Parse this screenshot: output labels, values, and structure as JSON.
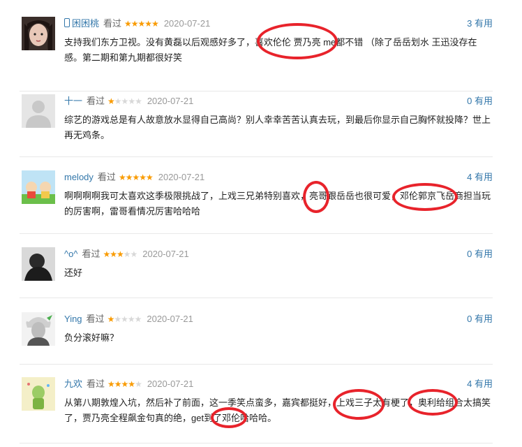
{
  "comments": [
    {
      "user": "困困桃",
      "phone_icon": true,
      "watched": "看过",
      "rating": 5,
      "date": "2020-07-21",
      "useful_count": "3",
      "useful_label": "有用",
      "text": "支持我们东方卫视。没有黄磊以后观感好多了，喜欢伦伦 贾乃亮 me都不错 （除了岳岳划水 王迅没存在感。第二期和第九期都很好笑",
      "avatar": "woman-photo"
    },
    {
      "user": "十一",
      "watched": "看过",
      "rating": 1,
      "date": "2020-07-21",
      "useful_count": "0",
      "useful_label": "有用",
      "text": "综艺的游戏总是有人故意放水显得自己高尚？别人幸幸苦苦认真去玩，到最后你显示自己胸怀就投降？世上再无鸡条。",
      "avatar": "default-avatar"
    },
    {
      "user": "melody",
      "watched": "看过",
      "rating": 5,
      "date": "2020-07-21",
      "useful_count": "4",
      "useful_label": "有用",
      "text": "啊啊啊啊我可太喜欢这季极限挑战了，上戏三兄弟特别喜欢，亮哥跟岳岳也很可爱，邓伦郭京飞岳商担当玩的厉害啊，雷哥看情况厉害哈哈哈",
      "avatar": "cartoon-avatar"
    },
    {
      "user": "^o^",
      "watched": "看过",
      "rating": 3,
      "date": "2020-07-21",
      "useful_count": "0",
      "useful_label": "有用",
      "text": "还好",
      "avatar": "dark-photo"
    },
    {
      "user": "Ying",
      "watched": "看过",
      "rating": 1,
      "date": "2020-07-21",
      "useful_count": "0",
      "useful_label": "有用",
      "text": "负分滚好嘛？",
      "avatar": "einstein-avatar"
    },
    {
      "user": "九欢",
      "watched": "看过",
      "rating": 4,
      "date": "2020-07-21",
      "useful_count": "4",
      "useful_label": "有用",
      "text": "从第八期敦煌入坑，然后补了前面，这一季笑点蛮多，嘉宾都挺好，上戏三子太有梗了，奥利给组合太搞笑了，贾乃亮全程飙金句真的绝，get到了邓伦哈哈哈。",
      "avatar": "illustration-avatar"
    }
  ],
  "colors": {
    "link": "#3377aa",
    "star": "#f99b01",
    "annotation": "#e8232b"
  }
}
